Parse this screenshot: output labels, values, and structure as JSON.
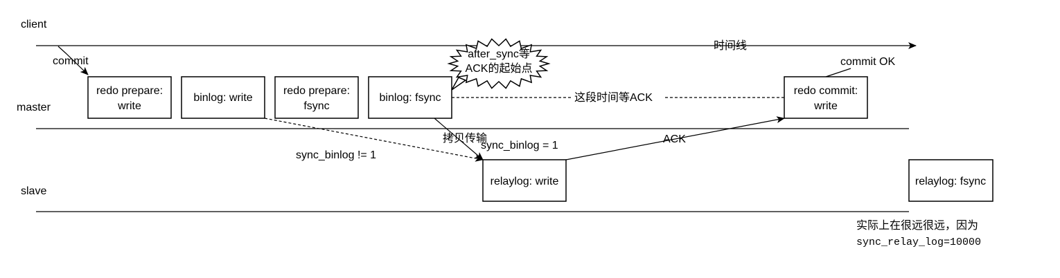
{
  "lanes": {
    "client": "client",
    "master": "master",
    "slave": "slave"
  },
  "timeline_label": "时间线",
  "commit_label": "commit",
  "commit_ok_label": "commit OK",
  "boxes": {
    "redo_prepare_write": [
      "redo prepare:",
      "write"
    ],
    "binlog_write": "binlog: write",
    "redo_prepare_fsync": [
      "redo prepare:",
      "fsync"
    ],
    "binlog_fsync": "binlog: fsync",
    "redo_commit_write": [
      "redo commit:",
      "write"
    ],
    "relaylog_write": "relaylog: write",
    "relaylog_fsync": "relaylog: fsync"
  },
  "callout": [
    "after_sync等",
    "ACK的起始点"
  ],
  "wait_ack_label": "这段时间等ACK",
  "copy_label": "拷贝传输",
  "sync_binlog_ne1": "sync_binlog != 1",
  "sync_binlog_eq1": "sync_binlog = 1",
  "ack_label": "ACK",
  "note": {
    "line1": "实际上在很远很远，因为",
    "line2": "sync_relay_log=10000"
  }
}
